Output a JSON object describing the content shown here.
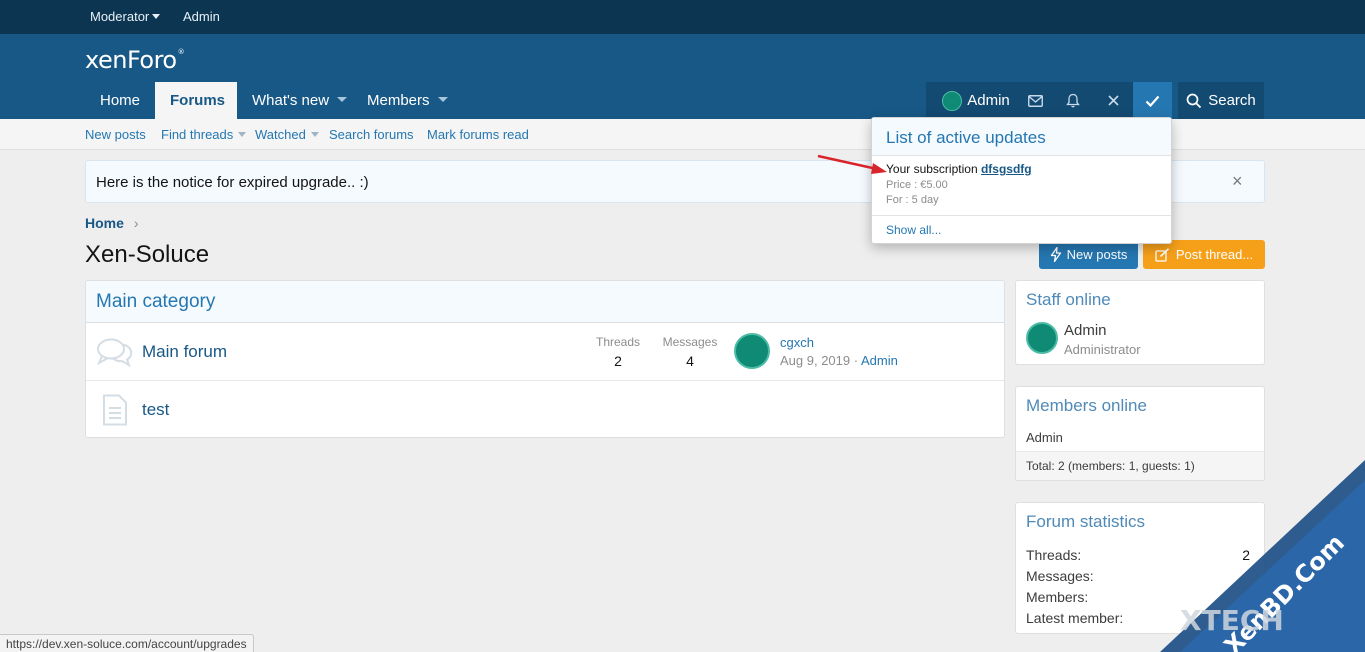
{
  "staffbar": {
    "moderator": "Moderator",
    "admin": "Admin"
  },
  "header": {
    "logo": "xenForo",
    "logo_mark": "®"
  },
  "nav": {
    "home": "Home",
    "forums": "Forums",
    "whats_new": "What's new",
    "members": "Members"
  },
  "useraccount": {
    "name": "Admin",
    "search": "Search"
  },
  "subnav": {
    "new_posts": "New posts",
    "find_threads": "Find threads",
    "watched": "Watched",
    "search_forums": "Search forums",
    "mark_read": "Mark forums read"
  },
  "notice": {
    "text": "Here is the notice for expired upgrade.. :)",
    "close": "×"
  },
  "breadcrumb": {
    "home": "Home",
    "sep": "›"
  },
  "page": {
    "title": "Xen-Soluce"
  },
  "buttons": {
    "new_posts": "New posts",
    "post_thread": "Post thread..."
  },
  "category": {
    "title": "Main category",
    "forums": [
      {
        "title": "Main forum",
        "threads_label": "Threads",
        "threads": "2",
        "messages_label": "Messages",
        "messages": "4",
        "latest_title": "cgxch",
        "latest_date": "Aug 9, 2019",
        "latest_sep": "·",
        "latest_user": "Admin"
      },
      {
        "title": "test"
      }
    ]
  },
  "staff_online": {
    "title": "Staff online",
    "name": "Admin",
    "role": "Administrator"
  },
  "members_online": {
    "title": "Members online",
    "member": "Admin",
    "total": "Total: 2 (members: 1, guests: 1)"
  },
  "forum_stats": {
    "title": "Forum statistics",
    "threads_label": "Threads:",
    "threads": "2",
    "messages_label": "Messages:",
    "members_label": "Members:",
    "latest_label": "Latest member:"
  },
  "popup": {
    "title": "List of active updates",
    "sub_prefix": "Your subscription",
    "sub_name": "dfsgsdfg",
    "price": "Price : €5.00",
    "duration": "For : 5 day",
    "show_all": "Show all..."
  },
  "statusbar": {
    "url": "https://dev.xen-soluce.com/account/upgrades"
  },
  "watermark": {
    "text": "XenBD.Com",
    "logo": "XTECH"
  },
  "colors": {
    "header": "#185886",
    "staffbar": "#0c3552",
    "link": "#2577b1",
    "accent": "#f6a01a"
  }
}
